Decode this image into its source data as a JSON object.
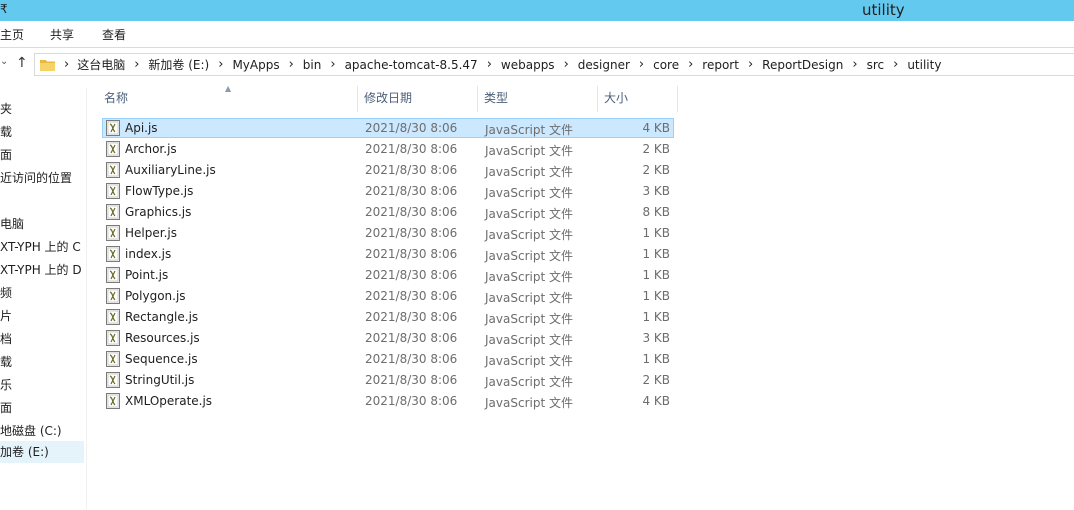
{
  "titlebar": {
    "qa_fragment": "₹",
    "title": "utility"
  },
  "ribbon": {
    "tabs": [
      "主页",
      "共享",
      "查看"
    ]
  },
  "nav": {
    "up_label": "↑",
    "down_label": "⌄"
  },
  "address": {
    "crumbs": [
      "这台电脑",
      "新加卷 (E:)",
      "MyApps",
      "bin",
      "apache-tomcat-8.5.47",
      "webapps",
      "designer",
      "core",
      "report",
      "ReportDesign",
      "src",
      "utility"
    ]
  },
  "navpane": {
    "items": [
      "夹",
      "载",
      "面",
      "近访问的位置",
      "",
      "电脑",
      "XT-YPH 上的 C",
      "XT-YPH 上的 D",
      "频",
      "片",
      "档",
      "载",
      "乐",
      "面",
      "地磁盘 (C:)",
      "加卷 (E:)"
    ]
  },
  "columns": {
    "name": "名称",
    "date": "修改日期",
    "type": "类型",
    "size": "大小"
  },
  "files": [
    {
      "name": "Api.js",
      "date": "2021/8/30 8:06",
      "type": "JavaScript 文件",
      "size": "4 KB"
    },
    {
      "name": "Archor.js",
      "date": "2021/8/30 8:06",
      "type": "JavaScript 文件",
      "size": "2 KB"
    },
    {
      "name": "AuxiliaryLine.js",
      "date": "2021/8/30 8:06",
      "type": "JavaScript 文件",
      "size": "2 KB"
    },
    {
      "name": "FlowType.js",
      "date": "2021/8/30 8:06",
      "type": "JavaScript 文件",
      "size": "3 KB"
    },
    {
      "name": "Graphics.js",
      "date": "2021/8/30 8:06",
      "type": "JavaScript 文件",
      "size": "8 KB"
    },
    {
      "name": "Helper.js",
      "date": "2021/8/30 8:06",
      "type": "JavaScript 文件",
      "size": "1 KB"
    },
    {
      "name": "index.js",
      "date": "2021/8/30 8:06",
      "type": "JavaScript 文件",
      "size": "1 KB"
    },
    {
      "name": "Point.js",
      "date": "2021/8/30 8:06",
      "type": "JavaScript 文件",
      "size": "1 KB"
    },
    {
      "name": "Polygon.js",
      "date": "2021/8/30 8:06",
      "type": "JavaScript 文件",
      "size": "1 KB"
    },
    {
      "name": "Rectangle.js",
      "date": "2021/8/30 8:06",
      "type": "JavaScript 文件",
      "size": "1 KB"
    },
    {
      "name": "Resources.js",
      "date": "2021/8/30 8:06",
      "type": "JavaScript 文件",
      "size": "3 KB"
    },
    {
      "name": "Sequence.js",
      "date": "2021/8/30 8:06",
      "type": "JavaScript 文件",
      "size": "1 KB"
    },
    {
      "name": "StringUtil.js",
      "date": "2021/8/30 8:06",
      "type": "JavaScript 文件",
      "size": "2 KB"
    },
    {
      "name": "XMLOperate.js",
      "date": "2021/8/30 8:06",
      "type": "JavaScript 文件",
      "size": "4 KB"
    }
  ],
  "selected_file_index": 0,
  "colors": {
    "titlebar": "#63c9ef",
    "selection": "#cce8ff",
    "selection_border": "#99d1ff",
    "folder": "#f2c94c"
  },
  "icons": {
    "file_icon": "javascript-file-icon",
    "folder_icon": "folder-icon"
  }
}
